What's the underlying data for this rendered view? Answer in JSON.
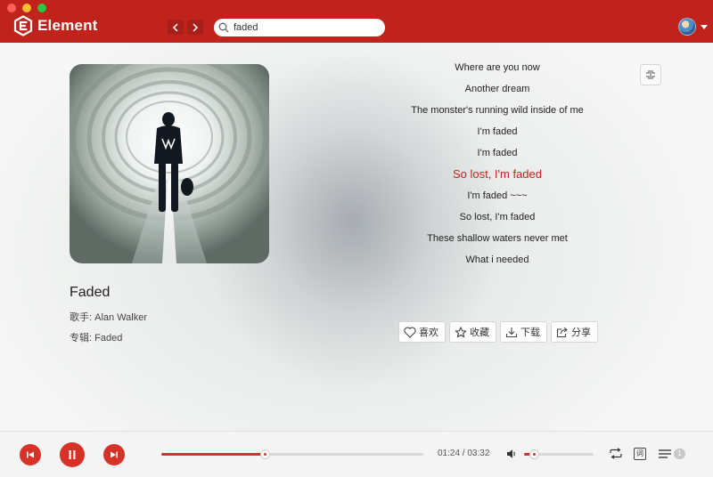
{
  "app": {
    "name": "Element"
  },
  "header": {
    "search": {
      "value": "faded"
    }
  },
  "song": {
    "title": "Faded",
    "artist_label": "歌手:",
    "artist": "Alan Walker",
    "album_label": "专辑:",
    "album": "Faded"
  },
  "lyrics": {
    "current_index": 5,
    "lines": [
      "Where are you now",
      "Another dream",
      "The monster's running wild inside of me",
      "I'm faded",
      "I'm faded",
      "So lost, I'm faded",
      "I'm faded ~~~",
      "So lost, I'm faded",
      "These shallow waters never met",
      "What i needed"
    ]
  },
  "actions": {
    "like": "喜欢",
    "collect": "收藏",
    "download": "下载",
    "share": "分享"
  },
  "player": {
    "time_display": "01:24 / 03:32",
    "progress_fraction": 0.396,
    "volume_fraction": 0.14,
    "lyric_toggle_label": "词",
    "playlist_count": "1"
  },
  "colors": {
    "brand": "#c0231c",
    "accent": "#d7322a"
  }
}
